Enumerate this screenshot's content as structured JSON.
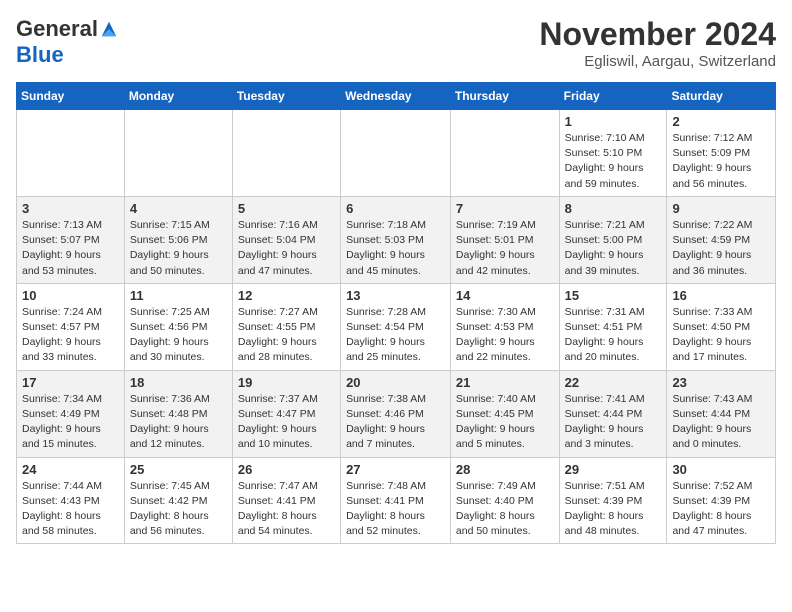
{
  "logo": {
    "general": "General",
    "blue": "Blue"
  },
  "header": {
    "month": "November 2024",
    "location": "Egliswil, Aargau, Switzerland"
  },
  "weekdays": [
    "Sunday",
    "Monday",
    "Tuesday",
    "Wednesday",
    "Thursday",
    "Friday",
    "Saturday"
  ],
  "weeks": [
    [
      {
        "day": "",
        "info": ""
      },
      {
        "day": "",
        "info": ""
      },
      {
        "day": "",
        "info": ""
      },
      {
        "day": "",
        "info": ""
      },
      {
        "day": "",
        "info": ""
      },
      {
        "day": "1",
        "info": "Sunrise: 7:10 AM\nSunset: 5:10 PM\nDaylight: 9 hours and 59 minutes."
      },
      {
        "day": "2",
        "info": "Sunrise: 7:12 AM\nSunset: 5:09 PM\nDaylight: 9 hours and 56 minutes."
      }
    ],
    [
      {
        "day": "3",
        "info": "Sunrise: 7:13 AM\nSunset: 5:07 PM\nDaylight: 9 hours and 53 minutes."
      },
      {
        "day": "4",
        "info": "Sunrise: 7:15 AM\nSunset: 5:06 PM\nDaylight: 9 hours and 50 minutes."
      },
      {
        "day": "5",
        "info": "Sunrise: 7:16 AM\nSunset: 5:04 PM\nDaylight: 9 hours and 47 minutes."
      },
      {
        "day": "6",
        "info": "Sunrise: 7:18 AM\nSunset: 5:03 PM\nDaylight: 9 hours and 45 minutes."
      },
      {
        "day": "7",
        "info": "Sunrise: 7:19 AM\nSunset: 5:01 PM\nDaylight: 9 hours and 42 minutes."
      },
      {
        "day": "8",
        "info": "Sunrise: 7:21 AM\nSunset: 5:00 PM\nDaylight: 9 hours and 39 minutes."
      },
      {
        "day": "9",
        "info": "Sunrise: 7:22 AM\nSunset: 4:59 PM\nDaylight: 9 hours and 36 minutes."
      }
    ],
    [
      {
        "day": "10",
        "info": "Sunrise: 7:24 AM\nSunset: 4:57 PM\nDaylight: 9 hours and 33 minutes."
      },
      {
        "day": "11",
        "info": "Sunrise: 7:25 AM\nSunset: 4:56 PM\nDaylight: 9 hours and 30 minutes."
      },
      {
        "day": "12",
        "info": "Sunrise: 7:27 AM\nSunset: 4:55 PM\nDaylight: 9 hours and 28 minutes."
      },
      {
        "day": "13",
        "info": "Sunrise: 7:28 AM\nSunset: 4:54 PM\nDaylight: 9 hours and 25 minutes."
      },
      {
        "day": "14",
        "info": "Sunrise: 7:30 AM\nSunset: 4:53 PM\nDaylight: 9 hours and 22 minutes."
      },
      {
        "day": "15",
        "info": "Sunrise: 7:31 AM\nSunset: 4:51 PM\nDaylight: 9 hours and 20 minutes."
      },
      {
        "day": "16",
        "info": "Sunrise: 7:33 AM\nSunset: 4:50 PM\nDaylight: 9 hours and 17 minutes."
      }
    ],
    [
      {
        "day": "17",
        "info": "Sunrise: 7:34 AM\nSunset: 4:49 PM\nDaylight: 9 hours and 15 minutes."
      },
      {
        "day": "18",
        "info": "Sunrise: 7:36 AM\nSunset: 4:48 PM\nDaylight: 9 hours and 12 minutes."
      },
      {
        "day": "19",
        "info": "Sunrise: 7:37 AM\nSunset: 4:47 PM\nDaylight: 9 hours and 10 minutes."
      },
      {
        "day": "20",
        "info": "Sunrise: 7:38 AM\nSunset: 4:46 PM\nDaylight: 9 hours and 7 minutes."
      },
      {
        "day": "21",
        "info": "Sunrise: 7:40 AM\nSunset: 4:45 PM\nDaylight: 9 hours and 5 minutes."
      },
      {
        "day": "22",
        "info": "Sunrise: 7:41 AM\nSunset: 4:44 PM\nDaylight: 9 hours and 3 minutes."
      },
      {
        "day": "23",
        "info": "Sunrise: 7:43 AM\nSunset: 4:44 PM\nDaylight: 9 hours and 0 minutes."
      }
    ],
    [
      {
        "day": "24",
        "info": "Sunrise: 7:44 AM\nSunset: 4:43 PM\nDaylight: 8 hours and 58 minutes."
      },
      {
        "day": "25",
        "info": "Sunrise: 7:45 AM\nSunset: 4:42 PM\nDaylight: 8 hours and 56 minutes."
      },
      {
        "day": "26",
        "info": "Sunrise: 7:47 AM\nSunset: 4:41 PM\nDaylight: 8 hours and 54 minutes."
      },
      {
        "day": "27",
        "info": "Sunrise: 7:48 AM\nSunset: 4:41 PM\nDaylight: 8 hours and 52 minutes."
      },
      {
        "day": "28",
        "info": "Sunrise: 7:49 AM\nSunset: 4:40 PM\nDaylight: 8 hours and 50 minutes."
      },
      {
        "day": "29",
        "info": "Sunrise: 7:51 AM\nSunset: 4:39 PM\nDaylight: 8 hours and 48 minutes."
      },
      {
        "day": "30",
        "info": "Sunrise: 7:52 AM\nSunset: 4:39 PM\nDaylight: 8 hours and 47 minutes."
      }
    ]
  ]
}
